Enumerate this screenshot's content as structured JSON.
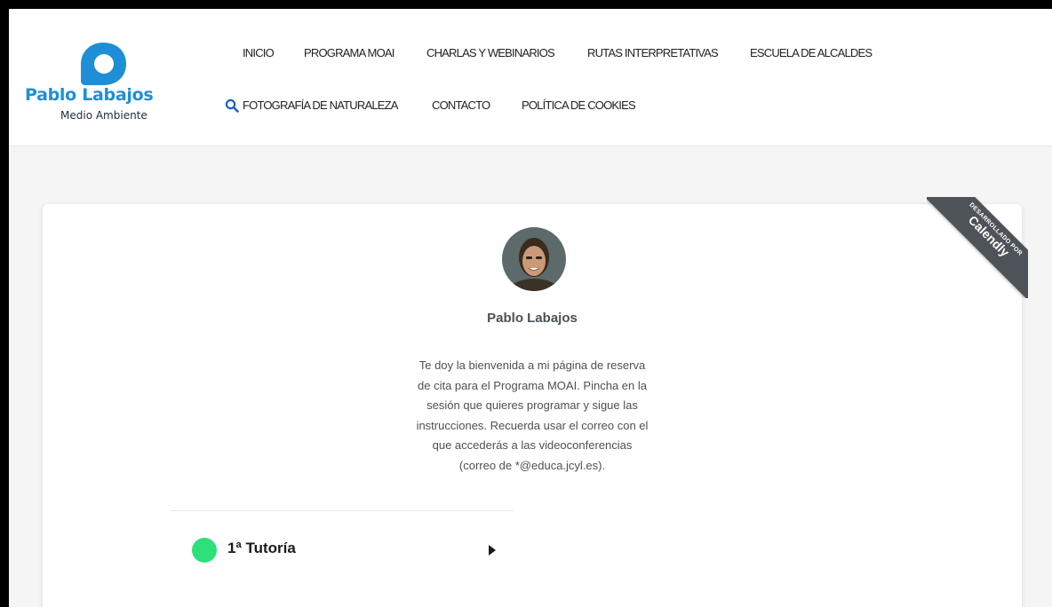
{
  "site": {
    "logo": {
      "title": "Pablo Labajos",
      "subtitle": "Medio Ambiente"
    },
    "nav": {
      "row1": [
        "INICIO",
        "PROGRAMA MOAI",
        "CHARLAS Y WEBINARIOS",
        "RUTAS INTERPRETATIVAS",
        "ESCUELA DE ALCALDES"
      ],
      "row2": [
        "FOTOGRAFÍA DE NATURALEZA",
        "CONTACTO",
        "POLÍTICA DE COOKIES"
      ]
    },
    "colors": {
      "brand": "#1e8fd6",
      "search_icon": "#1c5fbf",
      "event": "#2ee07a",
      "ribbon": "#4e5359"
    }
  },
  "calendly": {
    "host_name": "Pablo Labajos",
    "welcome": "Te doy la bienvenida a mi página de reserva\nde cita para el Programa MOAI. Pincha en la\nsesión que quieres programar y sigue las\ninstrucciones. Recuerda usar el correo con el\nque accederás a las videoconferencias\n(correo de *@educa.jcyl.es).",
    "events": [
      {
        "name": "1ª Tutoría",
        "color": "#2ee07a"
      }
    ],
    "ribbon": {
      "small": "DESARROLLADO POR",
      "brand": "Calendly"
    }
  }
}
